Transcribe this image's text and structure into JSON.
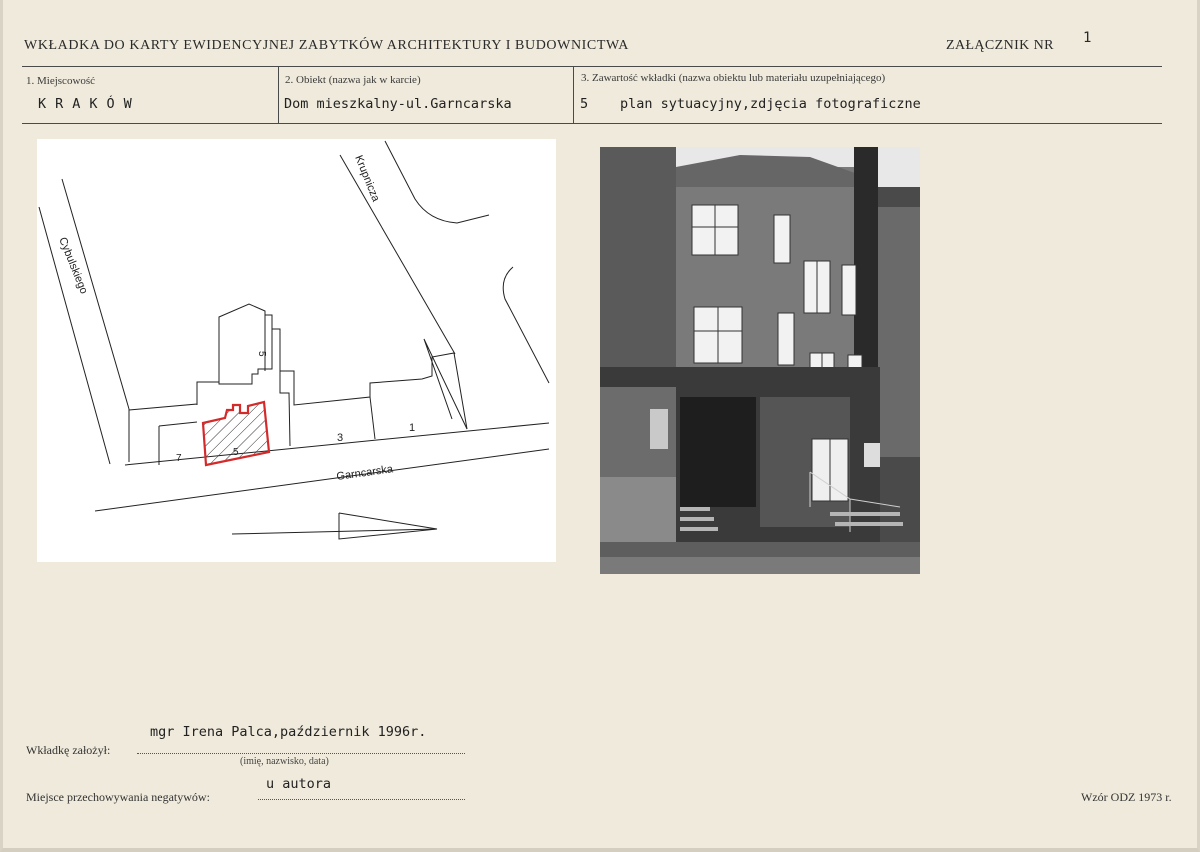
{
  "header": {
    "title": "WKŁADKA DO KARTY EWIDENCYJNEJ ZABYTKÓW ARCHITEKTURY I BUDOWNICTWA",
    "annex_label": "ZAŁĄCZNIK NR",
    "annex_number": "1"
  },
  "fields": {
    "locality_label": "1. Miejscowość",
    "locality_value": "KRAKÓW",
    "object_label": "2. Obiekt (nazwa jak w karcie)",
    "object_value": "Dom mieszkalny-ul.Garncarska",
    "contents_label": "3. Zawartość wkładki (nazwa obiektu lub materiału uzupełniającego)",
    "contents_number": "5",
    "contents_value": "plan sytuacyjny,zdjęcia fotograficzne"
  },
  "map": {
    "street_cybulskiego": "Cybulskiego",
    "street_krupnicza": "Krupnicza",
    "street_garncarska": "Garncarska",
    "plot_numbers": [
      "5",
      "3",
      "1",
      "7",
      "5"
    ],
    "highlight_color": "#d42a2a"
  },
  "footer": {
    "founder_label": "Wkładkę założył:",
    "founder_value": "mgr Irena Palca,październik 1996r.",
    "founder_caption": "(imię, nazwisko, data)",
    "negatives_label": "Miejsce przechowywania negatywów:",
    "negatives_value": "u autora",
    "form_model": "Wzór ODZ 1973 r."
  }
}
